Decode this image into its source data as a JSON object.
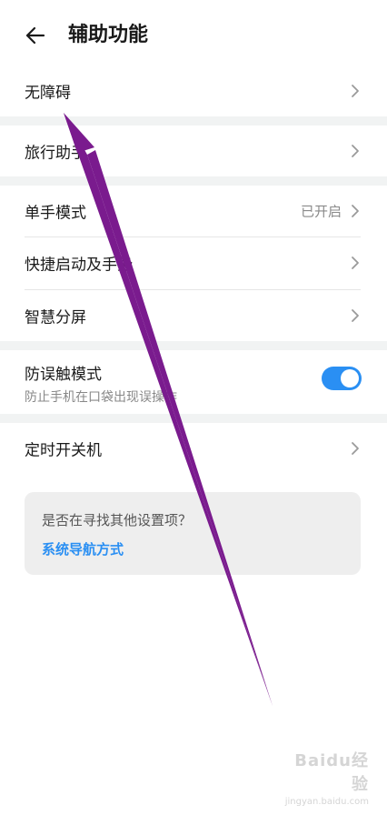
{
  "header": {
    "title": "辅助功能"
  },
  "rows": [
    {
      "label": "无障碍"
    },
    {
      "label": "旅行助手"
    },
    {
      "label": "单手模式",
      "value": "已开启"
    },
    {
      "label": "快捷启动及手势"
    },
    {
      "label": "智慧分屏"
    },
    {
      "label": "防误触模式",
      "sublabel": "防止手机在口袋出现误操作",
      "toggle_on": true
    },
    {
      "label": "定时开关机"
    }
  ],
  "card": {
    "question": "是否在寻找其他设置项？",
    "link": "系统导航方式"
  },
  "watermark": {
    "brand": "Baidu经验",
    "site": "jingyan.baidu.com"
  },
  "colors": {
    "accent": "#2a8ff3",
    "annotation_arrow": "#7a1b8e"
  }
}
